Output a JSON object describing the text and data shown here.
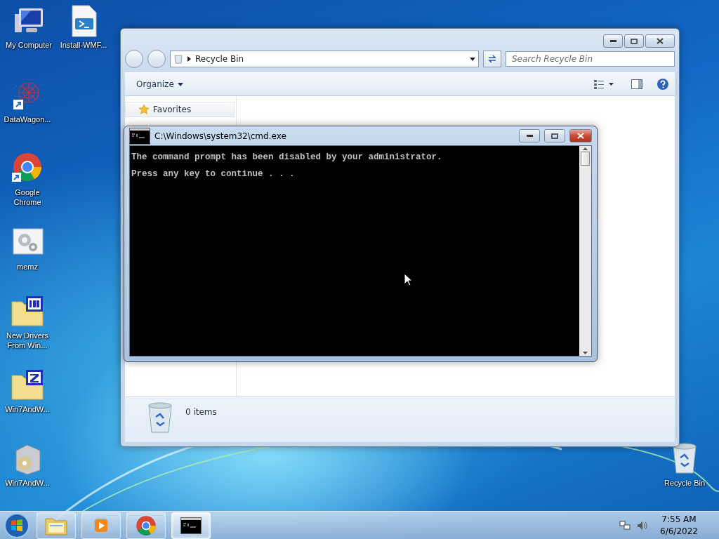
{
  "desktop_icons": [
    {
      "label": "My Computer",
      "kind": "computer"
    },
    {
      "label": "Install-WMF...",
      "kind": "script"
    },
    {
      "label": "DataWagon...",
      "kind": "shortcut"
    },
    {
      "label": "Google Chrome",
      "kind": "chrome"
    },
    {
      "label": "memz",
      "kind": "exe"
    },
    {
      "label": "New Drivers From Win...",
      "kind": "iso"
    },
    {
      "label": "Win7AndW...",
      "kind": "zip"
    },
    {
      "label": "Win7AndW...",
      "kind": "installer"
    },
    {
      "label": "Recycle Bin",
      "kind": "bin"
    }
  ],
  "explorer": {
    "address": "Recycle Bin",
    "search": {
      "placeholder": "Search Recycle Bin"
    },
    "toolbar": {
      "organize": "Organize"
    },
    "nav": {
      "favorites": "Favorites"
    },
    "status": "0 items"
  },
  "cmd": {
    "title": "C:\\Windows\\system32\\cmd.exe",
    "lines": [
      "The command prompt has been disabled by your administrator.",
      "Press any key to continue . . ."
    ]
  },
  "taskbar": {
    "items": [
      {
        "kind": "explorer",
        "active": false
      },
      {
        "kind": "media",
        "active": false
      },
      {
        "kind": "chrome",
        "active": false
      },
      {
        "kind": "cmd",
        "active": true
      }
    ],
    "time": "7:55 AM",
    "date": "6/6/2022"
  }
}
